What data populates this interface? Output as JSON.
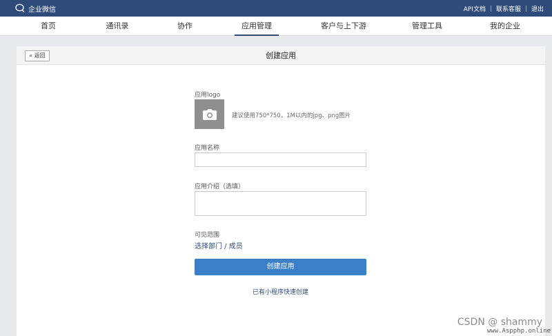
{
  "topbar": {
    "brand": "企业微信",
    "links": [
      "API文档",
      "联系客服",
      "退出"
    ]
  },
  "nav": {
    "items": [
      "首页",
      "通讯录",
      "协作",
      "应用管理",
      "客户与上下游",
      "管理工具",
      "我的企业"
    ],
    "active": "应用管理"
  },
  "panel": {
    "back_label": "« 返回",
    "title": "创建应用"
  },
  "form": {
    "logo_label": "应用logo",
    "logo_hint": "建议使用750*750，1M以内的jpg、png图片",
    "name_label": "应用名称",
    "name_value": "",
    "intro_label": "应用介绍（选填）",
    "intro_value": "",
    "range_label": "可见范围",
    "range_link": "选择部门 / 成员",
    "submit_label": "创建应用",
    "mini_link": "已有小程序快速创建"
  },
  "watermark": {
    "line1": "CSDN @ shammy",
    "line2": "www.Aspphp.online"
  },
  "colors": {
    "topbar": "#2e4b79",
    "primary_button": "#3b7fc9",
    "link": "#2e4b79"
  }
}
